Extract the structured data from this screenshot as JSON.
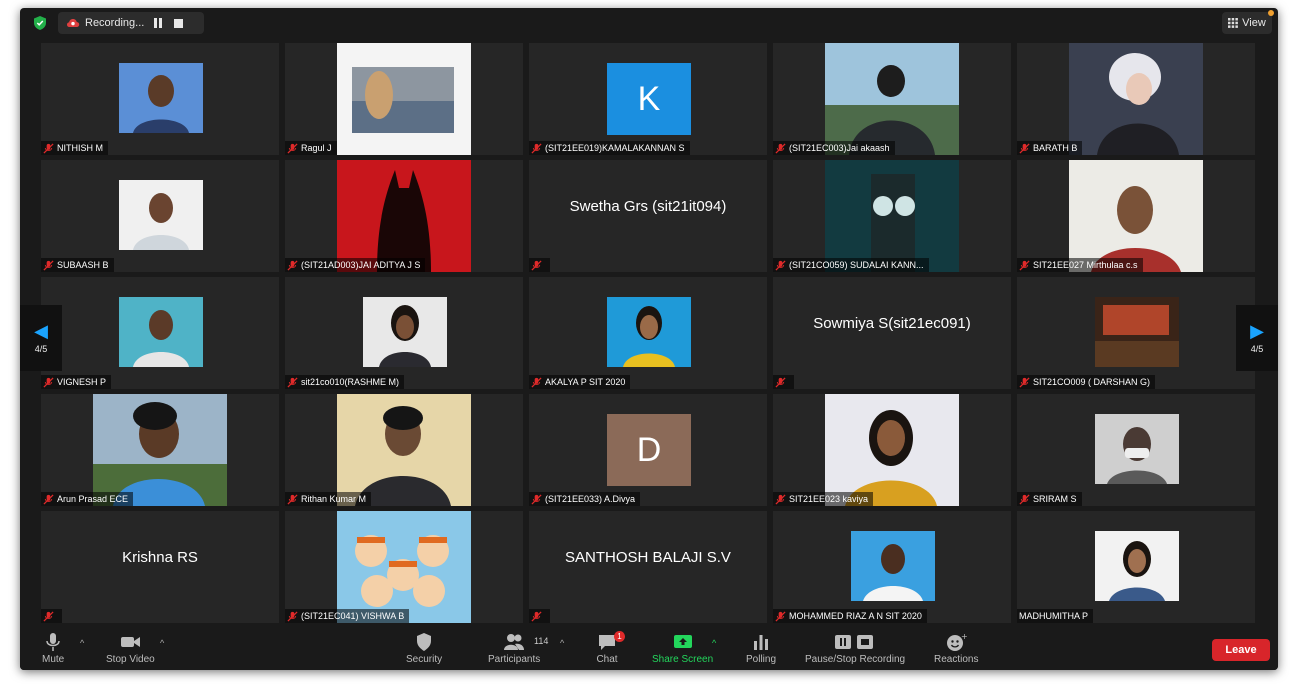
{
  "top_bar": {
    "recording_label": "Recording...",
    "view_label": "View"
  },
  "pagination": {
    "left_page": "4/5",
    "right_page": "4/5"
  },
  "participants": [
    {
      "name": "NITHISH M",
      "display": "photo"
    },
    {
      "name": "Ragul J",
      "display": "photo"
    },
    {
      "name": "(SIT21EE019)KAMALAKANNAN S",
      "display": "avatar",
      "letter": "K",
      "avatar_color": "#1b8fe0"
    },
    {
      "name": "(SIT21EC003)Jai akaash",
      "display": "photo"
    },
    {
      "name": "BARATH B",
      "display": "photo"
    },
    {
      "name": "SUBAASH B",
      "display": "photo"
    },
    {
      "name": "(SIT21AD003)JAI ADITYA J S",
      "display": "photo"
    },
    {
      "name": "",
      "display": "name",
      "big_name": "Swetha Grs (sit21it094)"
    },
    {
      "name": "(SIT21CO059) SUDALAI KANN...",
      "display": "photo"
    },
    {
      "name": "SIT21EE027 Mirthulaa c.s",
      "display": "photo"
    },
    {
      "name": "VIGNESH P",
      "display": "photo"
    },
    {
      "name": "sit21co010(RASHME M)",
      "display": "photo"
    },
    {
      "name": "AKALYA P SIT 2020",
      "display": "photo"
    },
    {
      "name": "",
      "display": "name",
      "big_name": "Sowmiya S(sit21ec091)"
    },
    {
      "name": "SIT21CO009 ( DARSHAN G)",
      "display": "photo"
    },
    {
      "name": "Arun Prasad ECE",
      "display": "photo"
    },
    {
      "name": "Rithan Kumar M",
      "display": "photo"
    },
    {
      "name": "(SIT21EE033) A.Divya",
      "display": "avatar",
      "letter": "D",
      "avatar_color": "#8b6a58"
    },
    {
      "name": "SIT21EE023 kaviya",
      "display": "photo"
    },
    {
      "name": "SRIRAM S",
      "display": "photo"
    },
    {
      "name": "",
      "display": "name",
      "big_name": "Krishna RS"
    },
    {
      "name": "(SIT21EC041) VISHWA B",
      "display": "photo"
    },
    {
      "name": "",
      "display": "name",
      "big_name": "SANTHOSH BALAJI S.V"
    },
    {
      "name": "MOHAMMED RIAZ A N SIT 2020",
      "display": "photo"
    },
    {
      "name": "MADHUMITHA P",
      "display": "photo"
    }
  ],
  "toolbar": {
    "mute_label": "Mute",
    "stop_video_label": "Stop Video",
    "security_label": "Security",
    "participants_label": "Participants",
    "participants_count": "114",
    "chat_label": "Chat",
    "chat_badge": "1",
    "share_screen_label": "Share Screen",
    "polling_label": "Polling",
    "pause_stop_recording_label": "Pause/Stop Recording",
    "reactions_label": "Reactions",
    "leave_label": "Leave"
  },
  "colors": {
    "background": "#1a1a1a",
    "tile": "#262626",
    "accent_blue": "#1aa4ff",
    "share_green": "#23d65c",
    "leave_red": "#d8252a",
    "muted_red": "#e02a2a"
  }
}
